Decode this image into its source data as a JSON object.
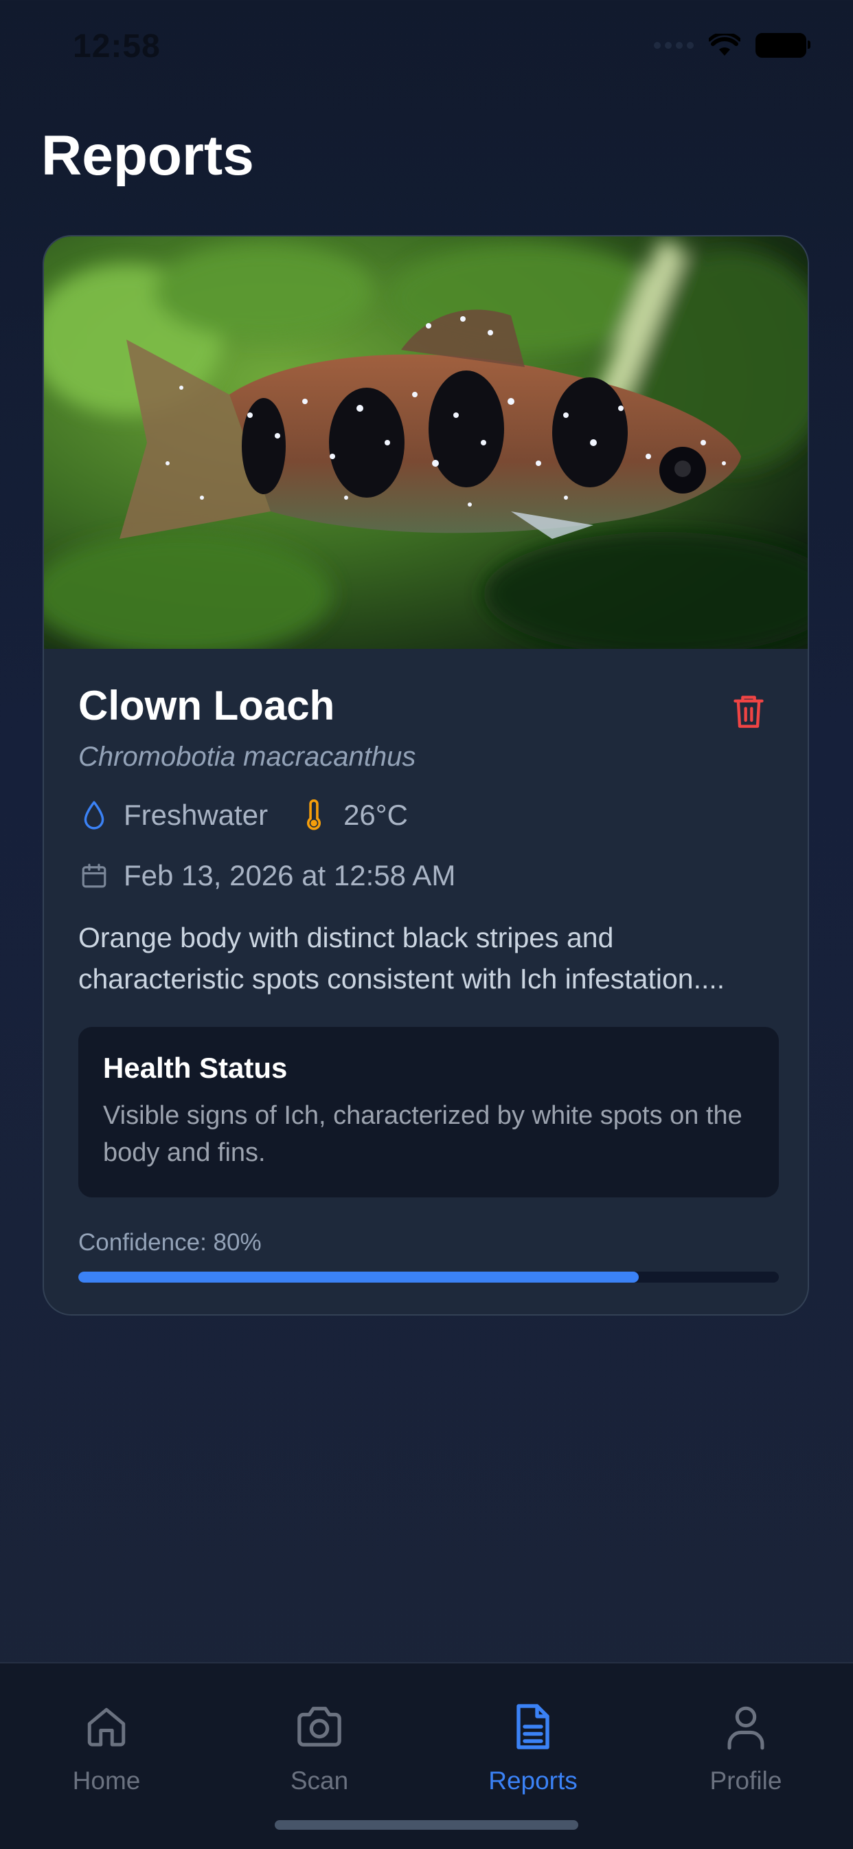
{
  "status_bar": {
    "time": "12:58"
  },
  "page": {
    "title": "Reports"
  },
  "report": {
    "name": "Clown Loach",
    "scientific_name": "Chromobotia macracanthus",
    "water_type": "Freshwater",
    "temperature": "26°C",
    "date": "Feb 13, 2026 at 12:58 AM",
    "description": "Orange body with distinct black stripes and characteristic spots consistent with Ich infestation....",
    "health": {
      "title": "Health Status",
      "text": "Visible signs of Ich, characterized by white spots on the body and fins."
    },
    "confidence_label": "Confidence: 80%",
    "confidence": 0.8
  },
  "tabs": [
    {
      "label": "Home",
      "icon": "home-icon",
      "active": false
    },
    {
      "label": "Scan",
      "icon": "camera-icon",
      "active": false
    },
    {
      "label": "Reports",
      "icon": "document-icon",
      "active": true
    },
    {
      "label": "Profile",
      "icon": "user-icon",
      "active": false
    }
  ],
  "colors": {
    "accent": "#3b82f6",
    "danger": "#ef4444",
    "temp_icon": "#f59e0b",
    "card_bg": "#1e293b"
  }
}
